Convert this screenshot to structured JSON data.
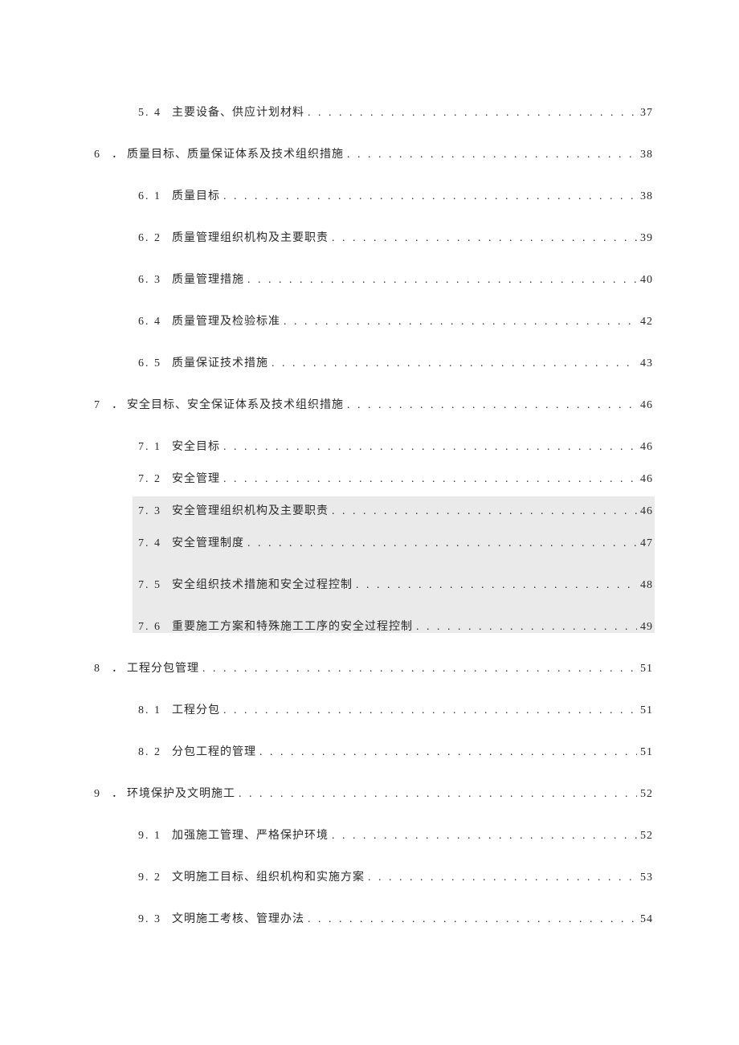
{
  "toc": {
    "e0": {
      "num": "5. 4",
      "title": "主要设备、供应计划材料",
      "page": "37"
    },
    "c6": {
      "num": "6",
      "title": "质量目标、质量保证体系及技术组织措施",
      "page": "38"
    },
    "e61": {
      "num": "6. 1",
      "title": "质量目标",
      "page": "38"
    },
    "e62": {
      "num": "6. 2",
      "title": "质量管理组织机构及主要职责",
      "page": "39"
    },
    "e63": {
      "num": "6. 3",
      "title": "质量管理措施",
      "page": "40"
    },
    "e64": {
      "num": "6. 4",
      "title": "质量管理及检验标准",
      "page": "42"
    },
    "e65": {
      "num": "6. 5",
      "title": "质量保证技术措施",
      "page": "43"
    },
    "c7": {
      "num": "7",
      "title": "安全目标、安全保证体系及技术组织措施",
      "page": "46"
    },
    "e71": {
      "num": "7. 1",
      "title": "安全目标",
      "page": "46"
    },
    "e72": {
      "num": "7. 2",
      "title": "安全管理",
      "page": "46"
    },
    "e73": {
      "num": "7. 3",
      "title": "安全管理组织机构及主要职责",
      "page": "46"
    },
    "e74": {
      "num": "7. 4",
      "title": "安全管理制度",
      "page": "47"
    },
    "e75": {
      "num": "7. 5",
      "title": "安全组织技术措施和安全过程控制",
      "page": "48"
    },
    "e76": {
      "num": "7. 6",
      "title": "重要施工方案和特殊施工工序的安全过程控制",
      "page": "49"
    },
    "c8": {
      "num": "8",
      "title": "工程分包管理",
      "page": "51"
    },
    "e81": {
      "num": "8. 1",
      "title": "工程分包",
      "page": "51"
    },
    "e82": {
      "num": "8. 2",
      "title": "分包工程的管理",
      "page": "51"
    },
    "c9": {
      "num": "9",
      "title": "环境保护及文明施工",
      "page": "52"
    },
    "e91": {
      "num": "9. 1",
      "title": "加强施工管理、严格保护环境",
      "page": "52"
    },
    "e92": {
      "num": "9. 2",
      "title": "文明施工目标、组织机构和实施方案",
      "page": "53"
    },
    "e93": {
      "num": "9. 3",
      "title": "文明施工考核、管理办法",
      "page": "54"
    }
  }
}
